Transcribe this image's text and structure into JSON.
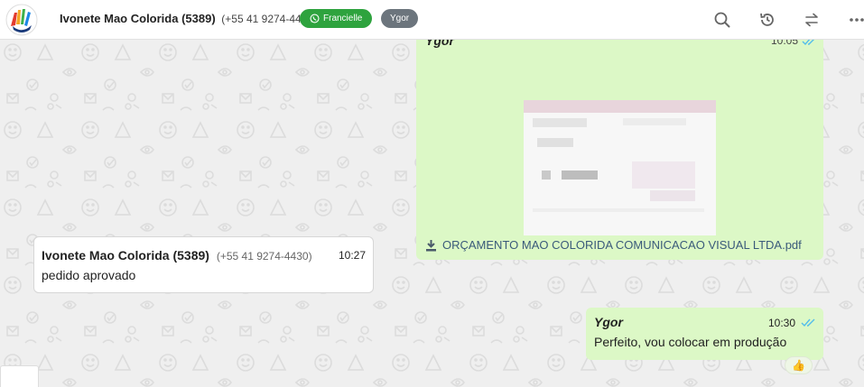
{
  "header": {
    "contact_name": "Ivonete Mao Colorida (5389)",
    "contact_phone": "(+55 41 9274-4430)",
    "tags": [
      {
        "label": "Francielle",
        "color": "#2ea33e",
        "icon": "whatsapp-icon"
      },
      {
        "label": "Ygor",
        "color": "#6c757d"
      }
    ],
    "actions": [
      "search-icon",
      "history-icon",
      "transfer-icon",
      "more-icon"
    ]
  },
  "messages": [
    {
      "direction": "outgoing",
      "sender": "Ygor",
      "time": "10:05",
      "status": "read",
      "attachment": {
        "filename": "ORÇAMENTO MAO COLORIDA COMUNICACAO VISUAL LTDA.pdf",
        "icon": "download-icon"
      }
    },
    {
      "direction": "incoming",
      "sender": "Ivonete Mao Colorida (5389)",
      "sender_phone": "(+55 41 9274-4430)",
      "time": "10:27",
      "text": "pedido aprovado"
    },
    {
      "direction": "outgoing",
      "sender": "Ygor",
      "time": "10:30",
      "status": "read",
      "text": "Perfeito, vou colocar em produção",
      "reaction": "👍"
    }
  ],
  "colors": {
    "outgoing_bubble": "#dcf8c6",
    "incoming_bubble": "#ffffff",
    "background": "#efefef",
    "read_check": "#53bdeb",
    "tag_green": "#2ea33e",
    "tag_gray": "#6c757d"
  }
}
